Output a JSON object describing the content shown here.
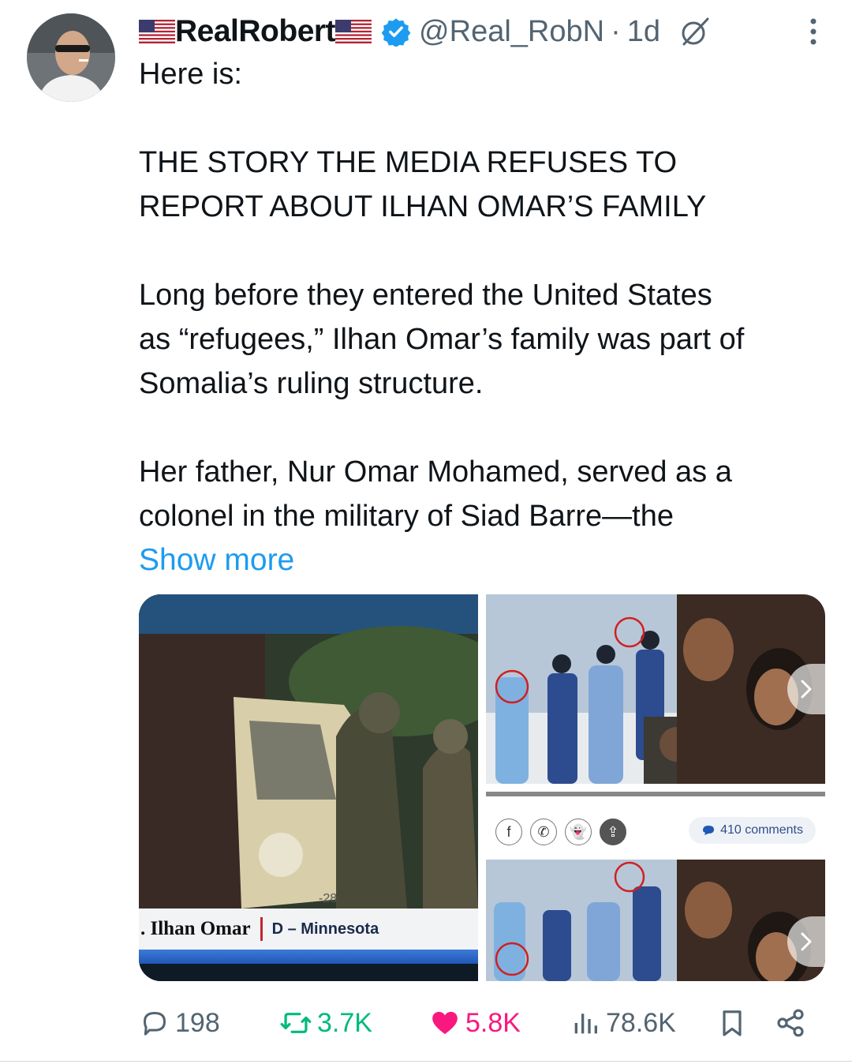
{
  "tweet": {
    "display_name": "RealRobert",
    "handle": "@Real_RobN",
    "separator": "·",
    "time": "1d",
    "verified": true,
    "icons": {
      "avatar": "avatar-photo",
      "verified": "verified-badge-icon",
      "flag": "us-flag-icon",
      "grok": "grok-icon",
      "more": "more-vertical-icon"
    },
    "text": {
      "intro": "Here is:",
      "headline_line1": "THE STORY THE MEDIA REFUSES TO",
      "headline_line2": "REPORT ABOUT ILHAN OMAR’S FAMILY",
      "p1_line1": "Long before they entered the United States",
      "p1_line2": "as “refugees,” Ilhan Omar’s family was part of",
      "p1_line3": "Somalia’s ruling structure.",
      "p2_line1": "Her father, Nur Omar Mohamed, served as a",
      "p2_line2": "colonel in the military of Siad Barre—the"
    },
    "show_more": "Show more"
  },
  "media": {
    "left_caption_name": ". Ilhan Omar",
    "left_caption_state": "D – Minnesota",
    "left_vehicle_mark": "-28",
    "right_comments": "410 comments",
    "share_icons": [
      "facebook-icon",
      "whatsapp-icon",
      "snapchat-icon",
      "share-upload-icon"
    ],
    "share_glyphs": [
      "f",
      "✆",
      "👻",
      "⇪"
    ]
  },
  "actions": {
    "replies": "198",
    "reposts": "3.7K",
    "likes": "5.8K",
    "views": "78.6K",
    "colors": {
      "default": "#536471",
      "repost": "#00ba7c",
      "like": "#f91880",
      "link": "#1d9bf0",
      "verified": "#1d9bf0"
    }
  }
}
